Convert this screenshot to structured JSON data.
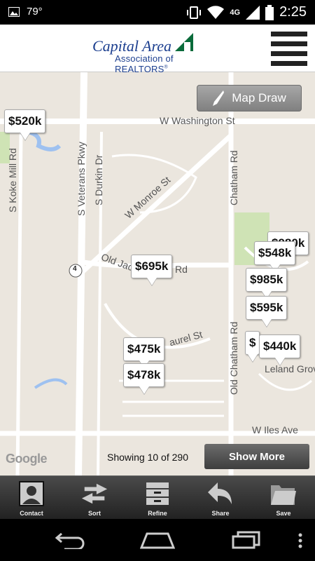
{
  "status": {
    "temperature": "79°",
    "network": "4G",
    "time": "2:25",
    "icons": [
      "image-icon",
      "vibrate-icon",
      "wifi-icon",
      "signal-icon",
      "battery-icon"
    ]
  },
  "header": {
    "logo_line1": "Capital Area",
    "logo_line2": "Association of REALTORS",
    "logo_mark": "®",
    "menu_icon": "hamburger-menu-icon",
    "brand_color": "#1c3f8f",
    "accent_color": "#0a6b3a"
  },
  "map": {
    "map_draw_label": "Map Draw",
    "roads": {
      "w_washington": "W Washington St",
      "s_veterans": "S Veterans Pkwy",
      "s_durkin": "S Durkin Dr",
      "w_monroe": "W Monroe St",
      "old_jacksonville": "Old Jac",
      "old_jacksonville_end": "Rd",
      "chatham": "Chatham Rd",
      "old_chatham": "Old Chatham Rd",
      "s_koke_mill": "S Koke Mill Rd",
      "laurel": "aurel St",
      "w_iles": "W Iles Ave",
      "leland_grove": "Leland Grove",
      "route": "4"
    },
    "prices": [
      "$520k",
      "$695k",
      "$475k",
      "$478k",
      "$980k",
      "$548k",
      "$985k",
      "$595k",
      "$",
      "$440k"
    ],
    "attribution": "Google",
    "showing_text": "Showing 10 of 290",
    "show_more_label": "Show More"
  },
  "toolbar": {
    "items": [
      {
        "label": "Contact",
        "icon": "contact-icon"
      },
      {
        "label": "Sort",
        "icon": "sort-arrows-icon"
      },
      {
        "label": "Refine",
        "icon": "refine-drawer-icon"
      },
      {
        "label": "Share",
        "icon": "share-arrow-icon"
      },
      {
        "label": "Save",
        "icon": "save-folder-icon"
      }
    ]
  },
  "navbar": {
    "icons": [
      "back-icon",
      "home-icon",
      "recent-apps-icon"
    ]
  }
}
